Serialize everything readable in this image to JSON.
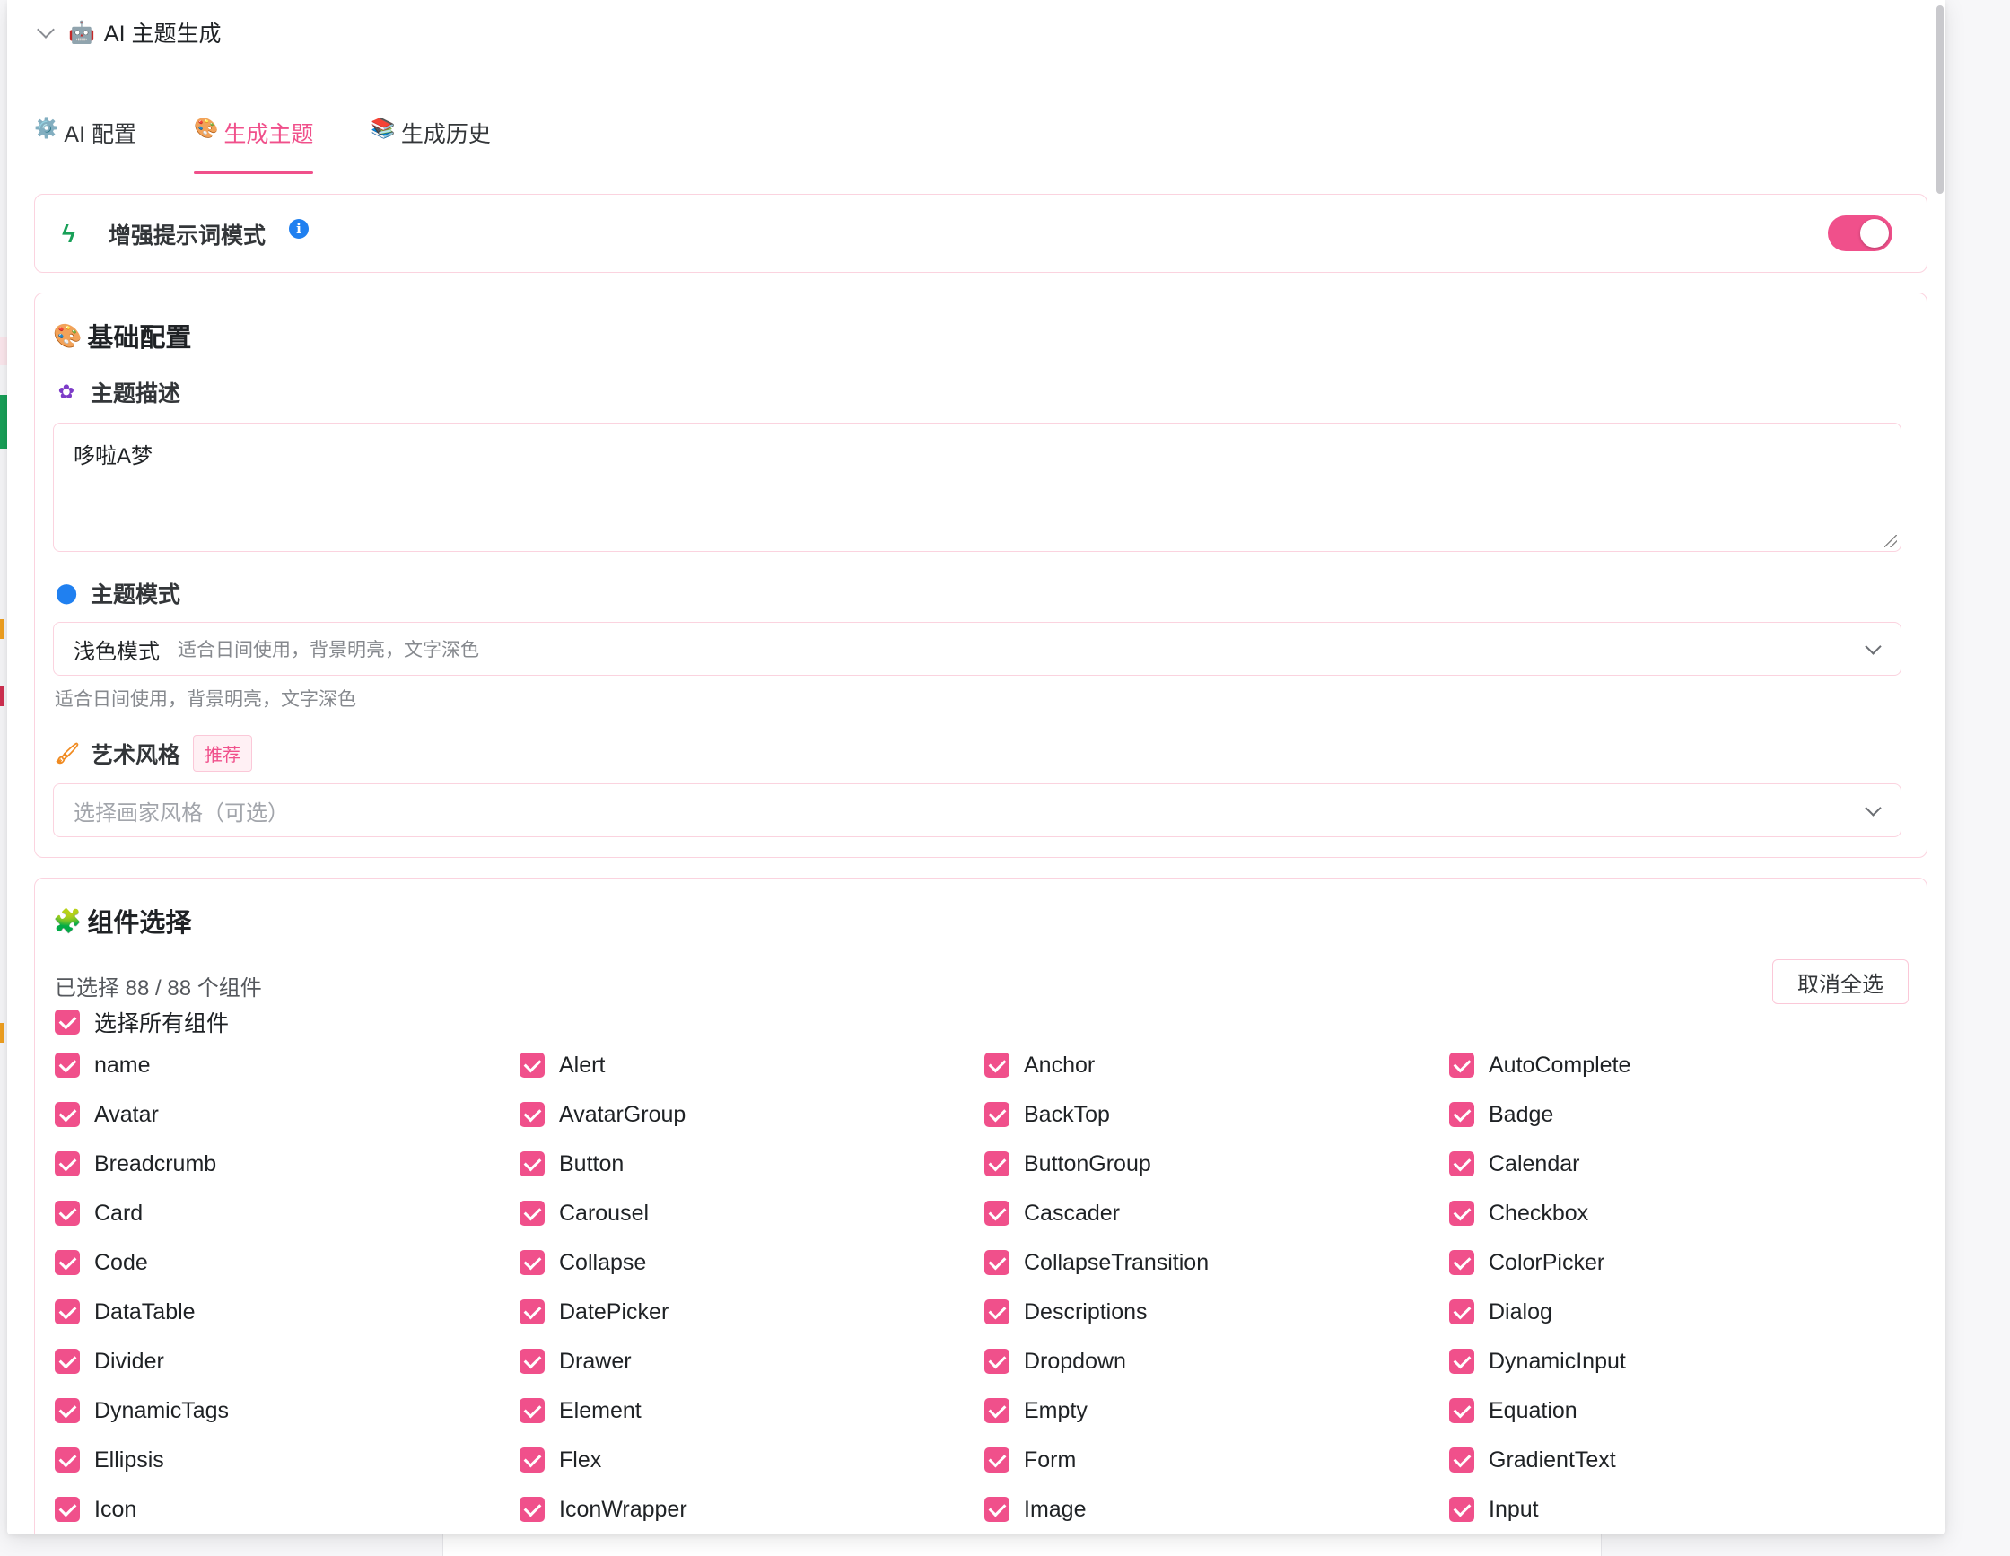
{
  "drawer": {
    "title": "AI 主题生成",
    "title_icon": "robot-icon"
  },
  "tabs": [
    {
      "label": "AI 配置",
      "icon": "gear-icon"
    },
    {
      "label": "生成主题",
      "icon": "palette-icon",
      "active": true
    },
    {
      "label": "生成历史",
      "icon": "books-icon"
    }
  ],
  "boost": {
    "label": "增强提示词模式",
    "enabled": true
  },
  "basic": {
    "title": "基础配置",
    "description_label": "主题描述",
    "description_value": "哆啦A梦",
    "mode_label": "主题模式",
    "mode_value": "浅色模式",
    "mode_sub": "适合日间使用，背景明亮，文字深色",
    "mode_help": "适合日间使用，背景明亮，文字深色",
    "style_label": "艺术风格",
    "style_tag": "推荐",
    "style_placeholder": "选择画家风格（可选）"
  },
  "components": {
    "title": "组件选择",
    "selected_text": "已选择 88 / 88 个组件",
    "deselect_label": "取消全选",
    "select_all_label": "选择所有组件",
    "items": [
      "name",
      "Alert",
      "Anchor",
      "AutoComplete",
      "Avatar",
      "AvatarGroup",
      "BackTop",
      "Badge",
      "Breadcrumb",
      "Button",
      "ButtonGroup",
      "Calendar",
      "Card",
      "Carousel",
      "Cascader",
      "Checkbox",
      "Code",
      "Collapse",
      "CollapseTransition",
      "ColorPicker",
      "DataTable",
      "DatePicker",
      "Descriptions",
      "Dialog",
      "Divider",
      "Drawer",
      "Dropdown",
      "DynamicInput",
      "DynamicTags",
      "Element",
      "Empty",
      "Equation",
      "Ellipsis",
      "Flex",
      "Form",
      "GradientText",
      "Icon",
      "IconWrapper",
      "Image",
      "Input"
    ]
  },
  "colors": {
    "accent": "#f0508b",
    "border": "#fbd3df",
    "success": "#18a058",
    "info": "#2080f0"
  }
}
